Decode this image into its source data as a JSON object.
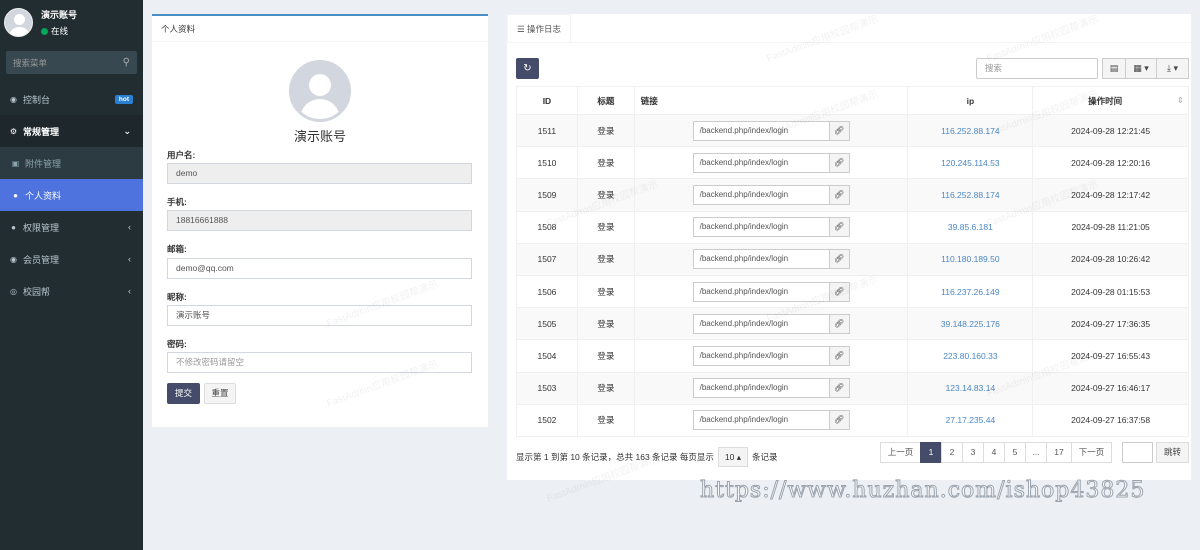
{
  "sidebar": {
    "user_name": "演示账号",
    "user_status": "在线",
    "search_placeholder": "搜索菜单",
    "items": [
      {
        "label": "控制台",
        "icon": "dashboard-icon",
        "badge": "hot"
      },
      {
        "label": "常规管理",
        "icon": "cogs-icon"
      },
      {
        "label": "附件管理",
        "icon": "file-image-icon"
      },
      {
        "label": "个人资料",
        "icon": "user-icon"
      },
      {
        "label": "权限管理",
        "icon": "group-icon"
      },
      {
        "label": "会员管理",
        "icon": "user-circle-icon"
      },
      {
        "label": "校园帮",
        "icon": "globe-icon"
      }
    ]
  },
  "profile": {
    "box_title": "个人资料",
    "display_name": "演示账号",
    "username_label": "用户名:",
    "username_value": "demo",
    "mobile_label": "手机:",
    "mobile_value": "18816661888",
    "email_label": "邮箱:",
    "email_value": "demo@qq.com",
    "nickname_label": "昵称:",
    "nickname_value": "演示账号",
    "password_label": "密码:",
    "password_placeholder": "不修改密码请留空",
    "submit_label": "提交",
    "reset_label": "重置"
  },
  "log": {
    "tab_label": "操作日志",
    "search_placeholder": "搜索",
    "columns": [
      "ID",
      "标题",
      "链接",
      "ip",
      "操作时间"
    ],
    "rows": [
      {
        "id": "1511",
        "title": "登录",
        "url": "/backend.php/index/login",
        "ip": "116.252.88.174",
        "time": "2024-09-28 12:21:45"
      },
      {
        "id": "1510",
        "title": "登录",
        "url": "/backend.php/index/login",
        "ip": "120.245.114.53",
        "time": "2024-09-28 12:20:16"
      },
      {
        "id": "1509",
        "title": "登录",
        "url": "/backend.php/index/login",
        "ip": "116.252.88.174",
        "time": "2024-09-28 12:17:42"
      },
      {
        "id": "1508",
        "title": "登录",
        "url": "/backend.php/index/login",
        "ip": "39.85.6.181",
        "time": "2024-09-28 11:21:05"
      },
      {
        "id": "1507",
        "title": "登录",
        "url": "/backend.php/index/login",
        "ip": "110.180.189.50",
        "time": "2024-09-28 10:26:42"
      },
      {
        "id": "1506",
        "title": "登录",
        "url": "/backend.php/index/login",
        "ip": "116.237.26.149",
        "time": "2024-09-28 01:15:53"
      },
      {
        "id": "1505",
        "title": "登录",
        "url": "/backend.php/index/login",
        "ip": "39.148.225.176",
        "time": "2024-09-27 17:36:35"
      },
      {
        "id": "1504",
        "title": "登录",
        "url": "/backend.php/index/login",
        "ip": "223.80.160.33",
        "time": "2024-09-27 16:55:43"
      },
      {
        "id": "1503",
        "title": "登录",
        "url": "/backend.php/index/login",
        "ip": "123.14.83.14",
        "time": "2024-09-27 16:46:17"
      },
      {
        "id": "1502",
        "title": "登录",
        "url": "/backend.php/index/login",
        "ip": "27.17.235.44",
        "time": "2024-09-27 16:37:58"
      }
    ],
    "pagination_text": "显示第 1 到第 10 条记录，总共 163 条记录 每页显示",
    "page_size": "10",
    "page_size_suffix": "条记录",
    "pages": [
      "上一页",
      "1",
      "2",
      "3",
      "4",
      "5",
      "...",
      "17",
      "下一页"
    ],
    "active_page": "1",
    "goto_label": "跳转"
  },
  "watermark": {
    "text": "FastAdmin应用校园帮演示",
    "url": "https://www.huzhan.com/ishop43825"
  }
}
